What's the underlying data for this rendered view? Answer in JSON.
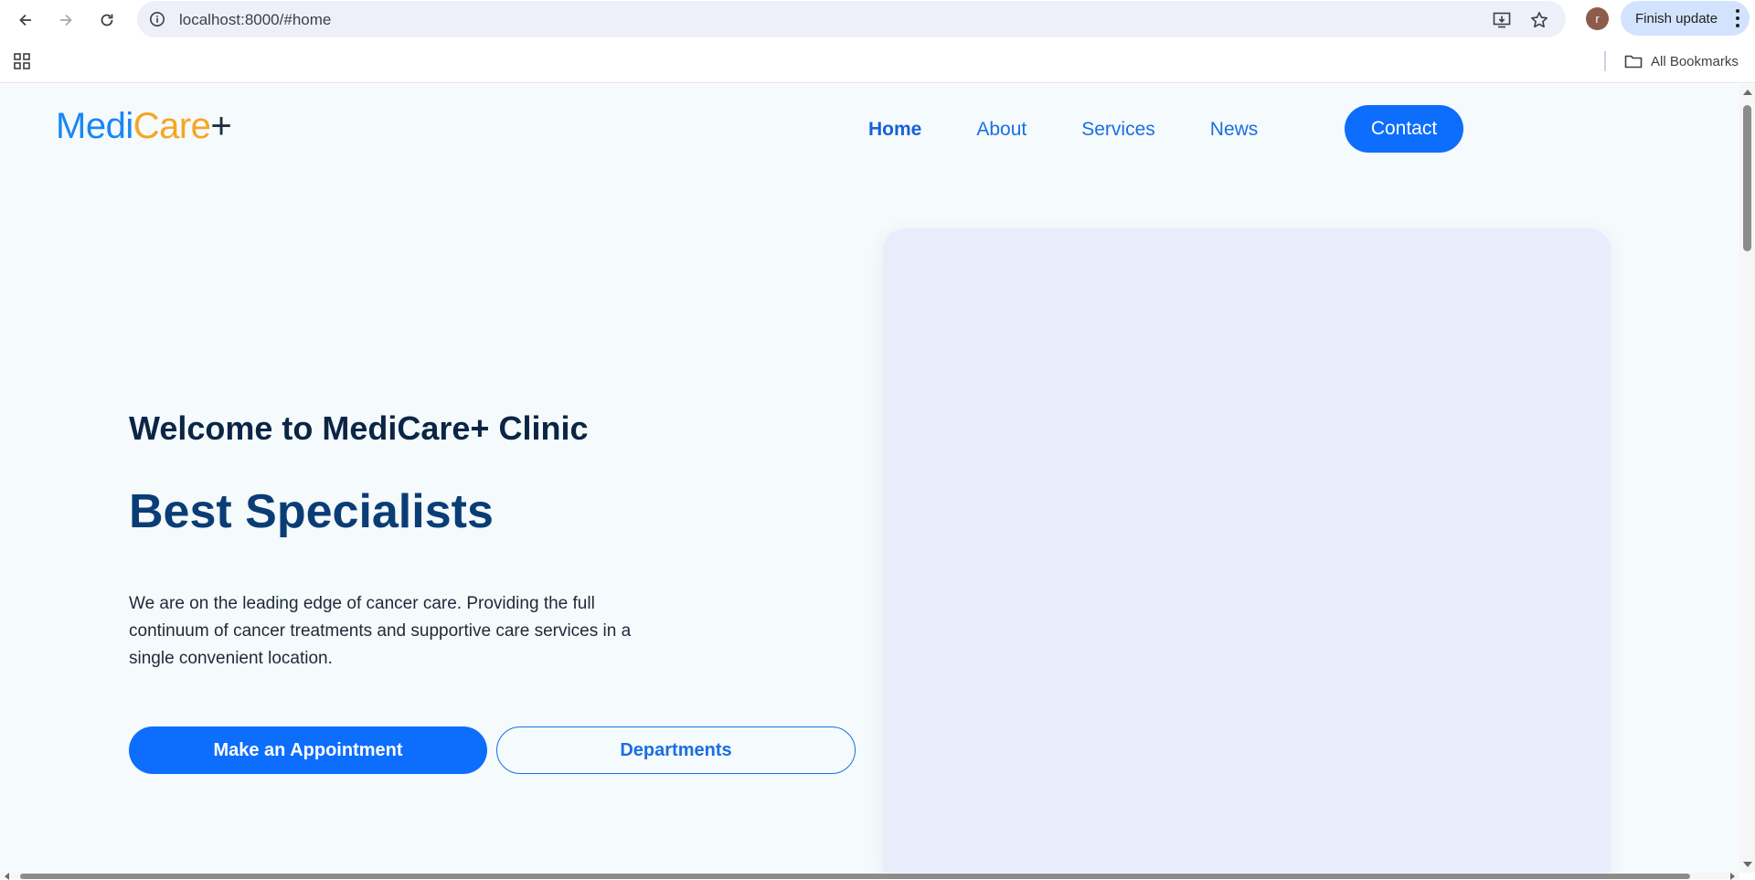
{
  "browser": {
    "url": "localhost:8000/#home",
    "finish_update_label": "Finish update",
    "avatar_initial": "r",
    "bookmarks_label": "All Bookmarks"
  },
  "site": {
    "logo": {
      "part1": "Medi",
      "part2": "Care",
      "part3": "+"
    },
    "nav": {
      "home": "Home",
      "about": "About",
      "services": "Services",
      "news": "News"
    },
    "contact_label": "Contact",
    "active_nav": "Home"
  },
  "hero": {
    "subtitle": "Welcome to MediCare+ Clinic",
    "title": "Best Specialists",
    "description": "We are on the leading edge of cancer care. Providing the full continuum of cancer treatments and supportive care services in a single convenient location.",
    "primary_button": "Make an Appointment",
    "secondary_button": "Departments"
  },
  "colors": {
    "accent_blue": "#0d6efd",
    "logo_blue": "#1a86f5",
    "logo_orange": "#f5a623",
    "page_background": "#f5fafc",
    "image_placeholder": "#e8edfc"
  }
}
